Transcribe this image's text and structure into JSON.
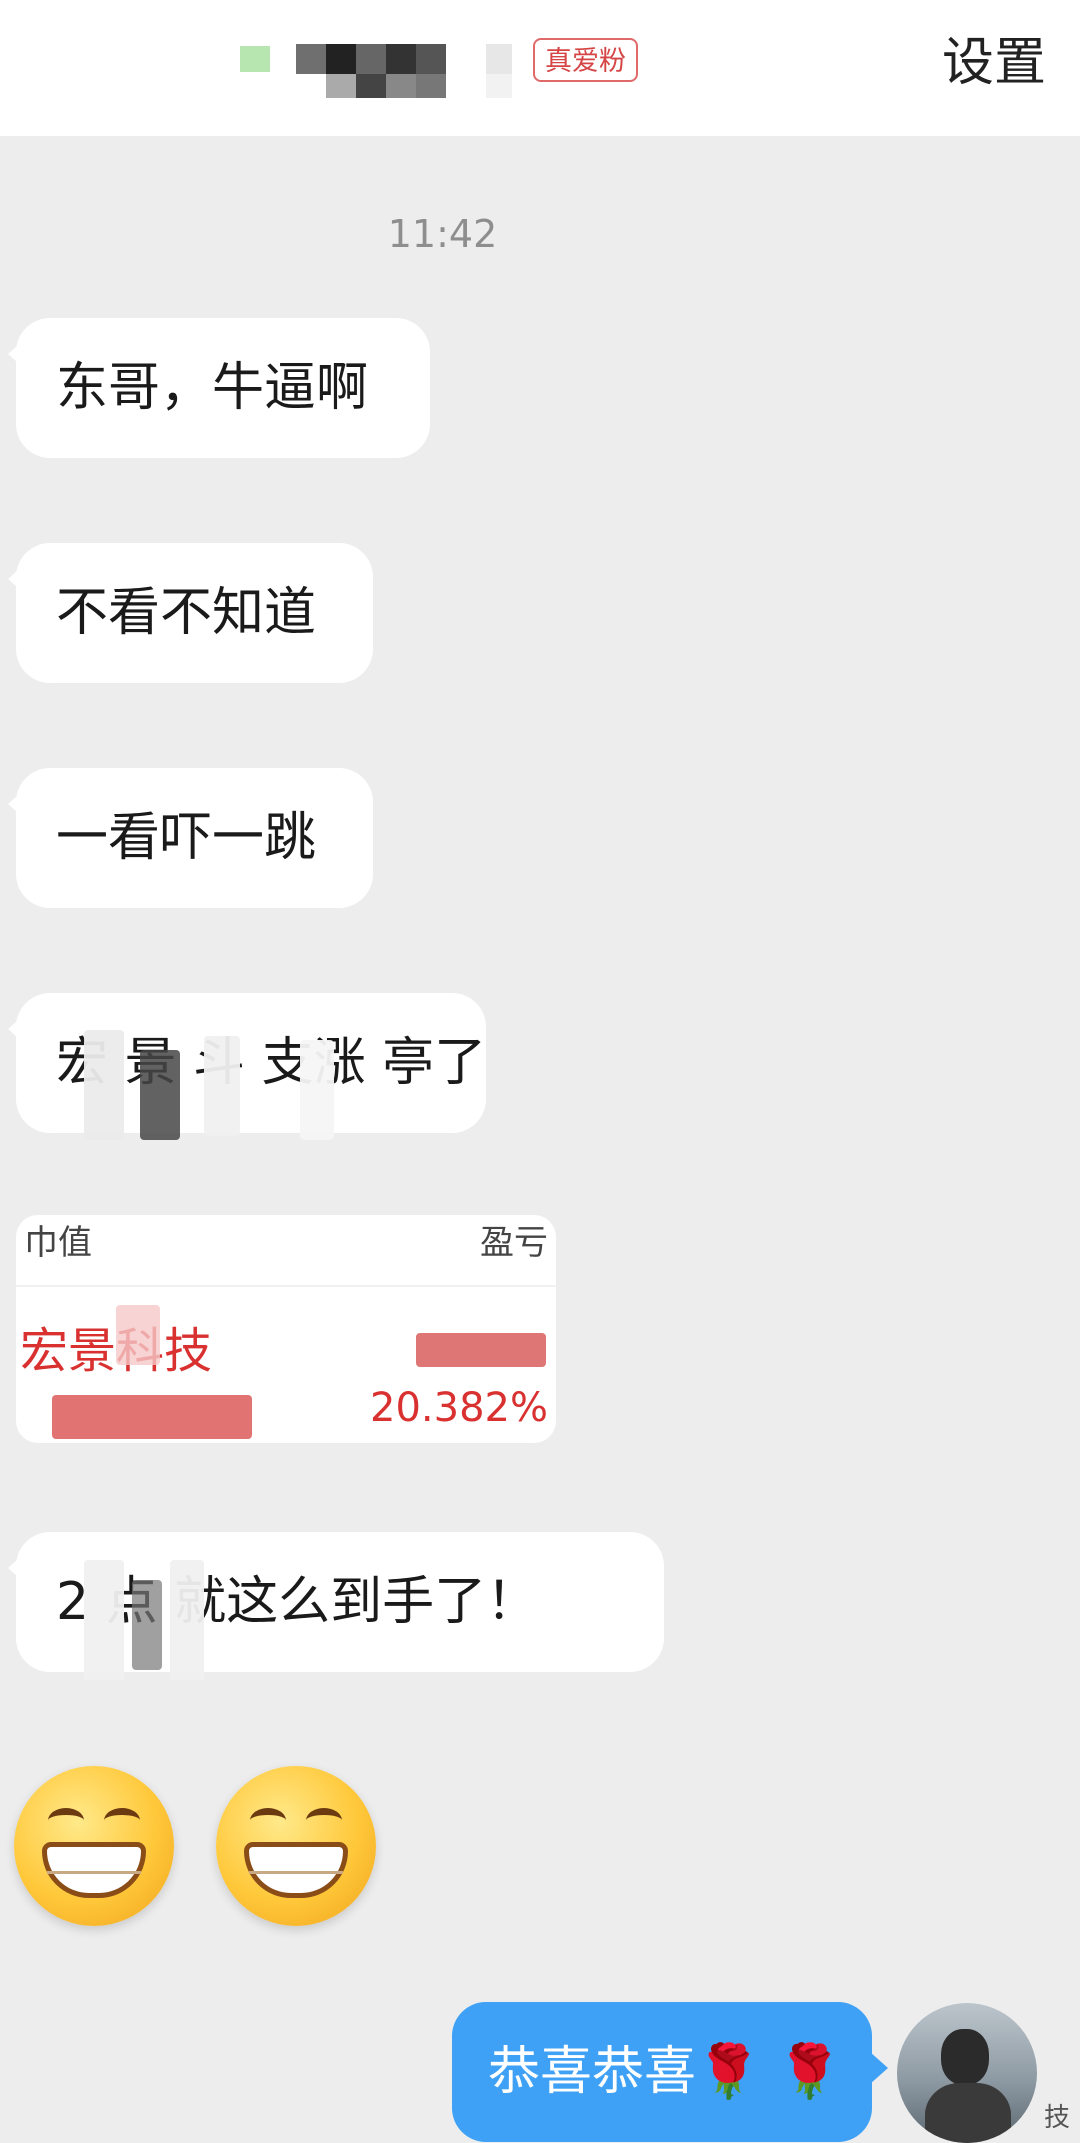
{
  "header": {
    "contact_name_hidden": "",
    "badge": "真爱粉",
    "settings_label": "设置"
  },
  "chat": {
    "timestamp": "11:42",
    "incoming": [
      "东哥，牛逼啊",
      "不看不知道",
      "一看吓一跳",
      "宏 景 斗 支涨 亭了",
      "2   点 就这么到手了！"
    ],
    "image_message": {
      "header_left": "巾值",
      "header_right": "盈亏",
      "stock_name": "宏景科技",
      "percent": "20.382%"
    },
    "emoji": [
      "😁",
      "😁"
    ],
    "outgoing": "恭喜恭喜🌹 🌹"
  },
  "watermark": "技",
  "colors": {
    "background": "#ededed",
    "bubble_in": "#ffffff",
    "bubble_out": "#3fa1f6",
    "badge": "#d64545",
    "stock_red": "#d93030"
  }
}
